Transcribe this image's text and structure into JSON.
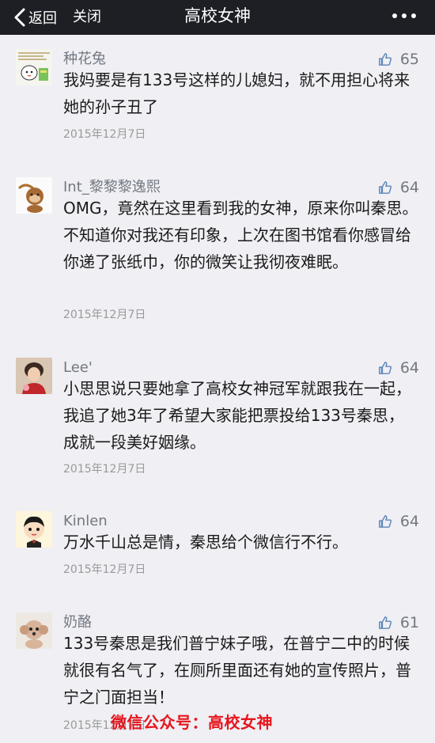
{
  "nav": {
    "back_label": "返回",
    "close_label": "关闭",
    "title": "高校女神",
    "bg_color": "#1d1f24"
  },
  "comments": [
    {
      "name": "种花兔",
      "likes": "65",
      "text": "我妈要是有133号这样的儿媳妇，就不用担心将来她的孙子丑了",
      "date": "2015年12月7日"
    },
    {
      "name": "Int_黎黎黎逸熙",
      "likes": "64",
      "text": "OMG，竟然在这里看到我的女神，原来你叫秦思。不知道你对我还有印象，上次在图书馆看你感冒给你递了张纸巾，你的微笑让我彻夜难眠。",
      "date": "2015年12月7日"
    },
    {
      "name": "Lee'",
      "likes": "64",
      "text": "小思思说只要她拿了高校女神冠军就跟我在一起，我追了她3年了希望大家能把票投给133号秦思，成就一段美好姻缘。",
      "date": "2015年12月7日"
    },
    {
      "name": "Kinlen",
      "likes": "64",
      "text": "万水千山总是情，秦思给个微信行不行。",
      "date": "2015年12月7日"
    },
    {
      "name": "奶酪",
      "likes": "61",
      "text": "133号秦思是我们普宁妹子哦，在普宁二中的时候就很有名气了，在厕所里面还有她的宣传照片，普宁之门面担当！",
      "date": "2015年12月7日"
    }
  ],
  "watermark": {
    "text": "微信公众号：高校女神",
    "color": "#e8141d"
  },
  "colors": {
    "background": "#efeff4",
    "meta_gray": "#737880",
    "like_icon": "#5b86b8"
  }
}
